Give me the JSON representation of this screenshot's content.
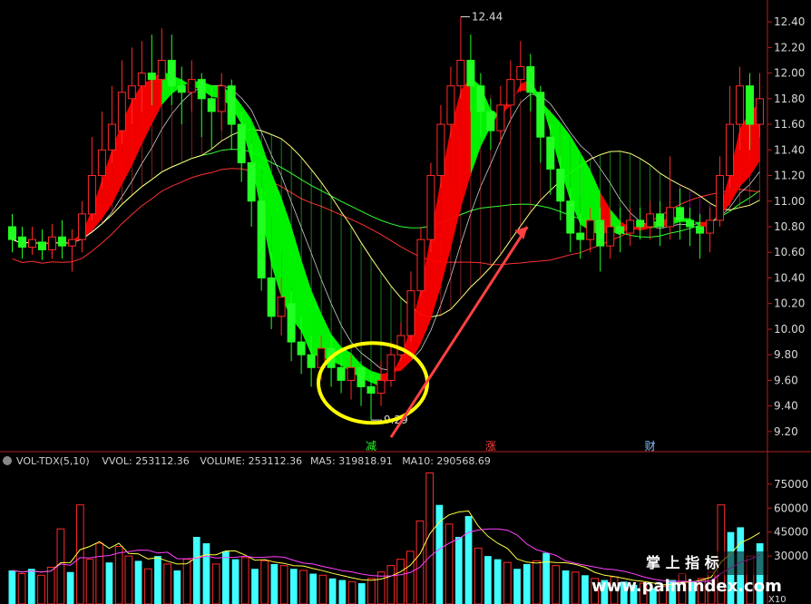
{
  "colors": {
    "up": "#ff2a2a",
    "down": "#22ff22",
    "ribbon_up": "#ff0000",
    "ribbon_down": "#00ff00",
    "magenta": "#ff00ff",
    "ma_long": "#ff3030",
    "ma_mid": "#30ff30",
    "ma_short": "#ffff80",
    "vol_up": "#ff2a2a",
    "vol_down": "#40ffff",
    "annotation_circle": "#ffff00",
    "annotation_arrow": "#ff4040"
  },
  "chart_data": [
    {
      "type": "candlestick",
      "y_ticks": [
        "12.40",
        "12.20",
        "12.00",
        "11.80",
        "11.60",
        "11.40",
        "11.20",
        "11.00",
        "10.80",
        "10.60",
        "10.40",
        "10.20",
        "10.00",
        "9.80",
        "9.60",
        "9.40",
        "9.20"
      ],
      "ylim": [
        9.1,
        12.5
      ],
      "annotations": {
        "high": "12.44",
        "low": "9.29"
      },
      "event_markers": [
        {
          "label": "减",
          "color": "#22ff22"
        },
        {
          "label": "涨",
          "color": "#ff4040"
        },
        {
          "label": "财",
          "color": "#80c0ff"
        }
      ],
      "candles": [
        {
          "o": 10.8,
          "c": 10.7,
          "h": 10.9,
          "l": 10.6
        },
        {
          "o": 10.72,
          "c": 10.64,
          "h": 10.8,
          "l": 10.55
        },
        {
          "o": 10.64,
          "c": 10.7,
          "h": 10.8,
          "l": 10.58
        },
        {
          "o": 10.68,
          "c": 10.62,
          "h": 10.78,
          "l": 10.54
        },
        {
          "o": 10.62,
          "c": 10.72,
          "h": 10.82,
          "l": 10.55
        },
        {
          "o": 10.72,
          "c": 10.65,
          "h": 10.85,
          "l": 10.55
        },
        {
          "o": 10.65,
          "c": 10.7,
          "h": 10.78,
          "l": 10.45
        },
        {
          "o": 10.7,
          "c": 10.9,
          "h": 11.0,
          "l": 10.6
        },
        {
          "o": 10.9,
          "c": 11.2,
          "h": 11.5,
          "l": 10.85
        },
        {
          "o": 11.2,
          "c": 11.4,
          "h": 11.7,
          "l": 11.1
        },
        {
          "o": 11.4,
          "c": 11.6,
          "h": 11.9,
          "l": 11.3
        },
        {
          "o": 11.55,
          "c": 11.85,
          "h": 12.1,
          "l": 11.45
        },
        {
          "o": 11.8,
          "c": 11.9,
          "h": 12.2,
          "l": 11.6
        },
        {
          "o": 11.9,
          "c": 12.0,
          "h": 12.25,
          "l": 11.7
        },
        {
          "o": 12.0,
          "c": 11.95,
          "h": 12.3,
          "l": 11.75
        },
        {
          "o": 11.95,
          "c": 12.1,
          "h": 12.35,
          "l": 11.85
        },
        {
          "o": 12.1,
          "c": 11.9,
          "h": 12.3,
          "l": 11.75
        },
        {
          "o": 11.9,
          "c": 11.85,
          "h": 12.05,
          "l": 11.6
        },
        {
          "o": 11.85,
          "c": 11.95,
          "h": 12.1,
          "l": 11.7
        },
        {
          "o": 11.95,
          "c": 11.8,
          "h": 12.0,
          "l": 11.5
        },
        {
          "o": 11.8,
          "c": 11.7,
          "h": 11.9,
          "l": 11.4
        },
        {
          "o": 11.7,
          "c": 11.9,
          "h": 12.0,
          "l": 11.55
        },
        {
          "o": 11.9,
          "c": 11.6,
          "h": 11.95,
          "l": 11.4
        },
        {
          "o": 11.6,
          "c": 11.3,
          "h": 11.7,
          "l": 11.15
        },
        {
          "o": 11.3,
          "c": 11.0,
          "h": 11.45,
          "l": 10.8
        },
        {
          "o": 11.0,
          "c": 10.4,
          "h": 11.1,
          "l": 10.3
        },
        {
          "o": 10.4,
          "c": 10.1,
          "h": 10.6,
          "l": 10.0
        },
        {
          "o": 10.1,
          "c": 10.25,
          "h": 10.4,
          "l": 9.95
        },
        {
          "o": 10.2,
          "c": 9.9,
          "h": 10.3,
          "l": 9.75
        },
        {
          "o": 9.9,
          "c": 9.8,
          "h": 10.1,
          "l": 9.65
        },
        {
          "o": 9.8,
          "c": 9.7,
          "h": 9.95,
          "l": 9.55
        },
        {
          "o": 9.7,
          "c": 9.85,
          "h": 9.95,
          "l": 9.6
        },
        {
          "o": 9.85,
          "c": 9.7,
          "h": 9.95,
          "l": 9.55
        },
        {
          "o": 9.7,
          "c": 9.6,
          "h": 9.8,
          "l": 9.5
        },
        {
          "o": 9.6,
          "c": 9.7,
          "h": 9.8,
          "l": 9.45
        },
        {
          "o": 9.7,
          "c": 9.55,
          "h": 9.75,
          "l": 9.4
        },
        {
          "o": 9.55,
          "c": 9.5,
          "h": 9.65,
          "l": 9.29
        },
        {
          "o": 9.5,
          "c": 9.6,
          "h": 9.75,
          "l": 9.4
        },
        {
          "o": 9.6,
          "c": 9.8,
          "h": 9.9,
          "l": 9.55
        },
        {
          "o": 9.8,
          "c": 9.95,
          "h": 10.05,
          "l": 9.75
        },
        {
          "o": 9.95,
          "c": 10.3,
          "h": 10.45,
          "l": 9.9
        },
        {
          "o": 10.3,
          "c": 10.7,
          "h": 10.8,
          "l": 10.25
        },
        {
          "o": 10.7,
          "c": 11.2,
          "h": 11.3,
          "l": 10.6
        },
        {
          "o": 11.2,
          "c": 11.6,
          "h": 11.75,
          "l": 11.1
        },
        {
          "o": 11.6,
          "c": 11.9,
          "h": 12.05,
          "l": 11.5
        },
        {
          "o": 11.9,
          "c": 12.1,
          "h": 12.44,
          "l": 11.8
        },
        {
          "o": 12.1,
          "c": 11.9,
          "h": 12.3,
          "l": 11.7
        },
        {
          "o": 11.9,
          "c": 11.7,
          "h": 12.0,
          "l": 11.5
        },
        {
          "o": 11.7,
          "c": 11.55,
          "h": 11.8,
          "l": 11.4
        },
        {
          "o": 11.55,
          "c": 11.75,
          "h": 11.9,
          "l": 11.45
        },
        {
          "o": 11.75,
          "c": 11.95,
          "h": 12.1,
          "l": 11.65
        },
        {
          "o": 11.95,
          "c": 12.05,
          "h": 12.25,
          "l": 11.85
        },
        {
          "o": 12.05,
          "c": 11.85,
          "h": 12.15,
          "l": 11.7
        },
        {
          "o": 11.85,
          "c": 11.5,
          "h": 11.9,
          "l": 11.3
        },
        {
          "o": 11.5,
          "c": 11.25,
          "h": 11.6,
          "l": 11.05
        },
        {
          "o": 11.25,
          "c": 11.0,
          "h": 11.35,
          "l": 10.85
        },
        {
          "o": 11.0,
          "c": 10.75,
          "h": 11.1,
          "l": 10.6
        },
        {
          "o": 10.75,
          "c": 10.7,
          "h": 10.9,
          "l": 10.55
        },
        {
          "o": 10.7,
          "c": 10.85,
          "h": 10.95,
          "l": 10.6
        },
        {
          "o": 10.85,
          "c": 10.65,
          "h": 10.95,
          "l": 10.45
        },
        {
          "o": 10.65,
          "c": 10.8,
          "h": 10.9,
          "l": 10.55
        },
        {
          "o": 10.8,
          "c": 10.75,
          "h": 10.95,
          "l": 10.6
        },
        {
          "o": 10.75,
          "c": 10.85,
          "h": 10.95,
          "l": 10.65
        },
        {
          "o": 10.85,
          "c": 10.8,
          "h": 10.95,
          "l": 10.7
        },
        {
          "o": 10.8,
          "c": 10.9,
          "h": 11.0,
          "l": 10.7
        },
        {
          "o": 10.9,
          "c": 10.8,
          "h": 11.0,
          "l": 10.65
        },
        {
          "o": 10.8,
          "c": 10.95,
          "h": 11.35,
          "l": 10.7
        },
        {
          "o": 10.95,
          "c": 10.85,
          "h": 11.1,
          "l": 10.7
        },
        {
          "o": 10.85,
          "c": 10.8,
          "h": 10.95,
          "l": 10.65
        },
        {
          "o": 10.8,
          "c": 10.75,
          "h": 10.9,
          "l": 10.55
        },
        {
          "o": 10.75,
          "c": 10.85,
          "h": 10.95,
          "l": 10.6
        },
        {
          "o": 10.85,
          "c": 11.2,
          "h": 11.35,
          "l": 10.8
        },
        {
          "o": 11.2,
          "c": 11.6,
          "h": 11.9,
          "l": 11.1
        },
        {
          "o": 11.6,
          "c": 11.9,
          "h": 12.05,
          "l": 11.4
        },
        {
          "o": 11.9,
          "c": 11.6,
          "h": 12.0,
          "l": 11.4
        },
        {
          "o": 11.6,
          "c": 11.8,
          "h": 12.0,
          "l": 11.5
        }
      ]
    },
    {
      "type": "bar",
      "indicator": "VOL-TDX(5,10)",
      "header": [
        {
          "text": "VOL-TDX(5,10)",
          "color": "#d0d0d0"
        },
        {
          "text": "VVOL: 253112.36",
          "color": "#ffffff"
        },
        {
          "text": "VOLUME: 253112.36",
          "color": "#ffff40"
        },
        {
          "text": "MA5: 319818.91",
          "color": "#ffff40"
        },
        {
          "text": "MA10: 290568.69",
          "color": "#ff40ff"
        }
      ],
      "y_ticks": [
        "75000",
        "60000",
        "45000",
        "30000"
      ],
      "ylim": [
        0,
        80000
      ],
      "axis_unit": "X10",
      "volumes": [
        {
          "v": 21000,
          "up": false
        },
        {
          "v": 19000,
          "up": true
        },
        {
          "v": 22000,
          "up": false
        },
        {
          "v": 18000,
          "up": true
        },
        {
          "v": 23000,
          "up": true
        },
        {
          "v": 47000,
          "up": true
        },
        {
          "v": 20000,
          "up": false
        },
        {
          "v": 62000,
          "up": true
        },
        {
          "v": 28000,
          "up": true
        },
        {
          "v": 38000,
          "up": true
        },
        {
          "v": 26000,
          "up": false
        },
        {
          "v": 36000,
          "up": true
        },
        {
          "v": 30000,
          "up": true
        },
        {
          "v": 27000,
          "up": false
        },
        {
          "v": 22000,
          "up": true
        },
        {
          "v": 30000,
          "up": false
        },
        {
          "v": 25000,
          "up": true
        },
        {
          "v": 21000,
          "up": false
        },
        {
          "v": 28000,
          "up": true
        },
        {
          "v": 42000,
          "up": false
        },
        {
          "v": 38000,
          "up": false
        },
        {
          "v": 25000,
          "up": true
        },
        {
          "v": 33000,
          "up": false
        },
        {
          "v": 28000,
          "up": false
        },
        {
          "v": 29000,
          "up": true
        },
        {
          "v": 22000,
          "up": false
        },
        {
          "v": 27000,
          "up": true
        },
        {
          "v": 25000,
          "up": false
        },
        {
          "v": 24000,
          "up": true
        },
        {
          "v": 22000,
          "up": false
        },
        {
          "v": 21000,
          "up": true
        },
        {
          "v": 19000,
          "up": false
        },
        {
          "v": 18000,
          "up": true
        },
        {
          "v": 16000,
          "up": false
        },
        {
          "v": 15000,
          "up": false
        },
        {
          "v": 14000,
          "up": true
        },
        {
          "v": 13000,
          "up": false
        },
        {
          "v": 16000,
          "up": true
        },
        {
          "v": 20000,
          "up": true
        },
        {
          "v": 24000,
          "up": true
        },
        {
          "v": 28000,
          "up": true
        },
        {
          "v": 33000,
          "up": true
        },
        {
          "v": 52000,
          "up": true
        },
        {
          "v": 82000,
          "up": true
        },
        {
          "v": 62000,
          "up": false
        },
        {
          "v": 50000,
          "up": true
        },
        {
          "v": 42000,
          "up": false
        },
        {
          "v": 55000,
          "up": false
        },
        {
          "v": 35000,
          "up": true
        },
        {
          "v": 30000,
          "up": false
        },
        {
          "v": 28000,
          "up": false
        },
        {
          "v": 26000,
          "up": true
        },
        {
          "v": 22000,
          "up": false
        },
        {
          "v": 25000,
          "up": false
        },
        {
          "v": 27000,
          "up": true
        },
        {
          "v": 32000,
          "up": false
        },
        {
          "v": 24000,
          "up": true
        },
        {
          "v": 21000,
          "up": false
        },
        {
          "v": 20000,
          "up": true
        },
        {
          "v": 18000,
          "up": false
        },
        {
          "v": 16000,
          "up": true
        },
        {
          "v": 15000,
          "up": false
        },
        {
          "v": 17000,
          "up": true
        },
        {
          "v": 14000,
          "up": false
        },
        {
          "v": 12000,
          "up": false
        },
        {
          "v": 13000,
          "up": true
        },
        {
          "v": 10000,
          "up": false
        },
        {
          "v": 11000,
          "up": true
        },
        {
          "v": 15000,
          "up": false
        },
        {
          "v": 19000,
          "up": true
        },
        {
          "v": 14000,
          "up": false
        },
        {
          "v": 16000,
          "up": true
        },
        {
          "v": 20000,
          "up": true
        },
        {
          "v": 62000,
          "up": true
        },
        {
          "v": 45000,
          "up": false
        },
        {
          "v": 48000,
          "up": false
        },
        {
          "v": 30000,
          "up": true
        },
        {
          "v": 38000,
          "up": false
        }
      ]
    }
  ],
  "watermark": {
    "line1": "掌 上 指 标",
    "line2": "www.palmindex.com"
  }
}
